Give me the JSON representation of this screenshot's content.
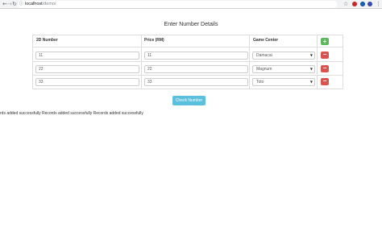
{
  "browser": {
    "url_host": "localhost",
    "url_path": "/demo/",
    "info_icon": "info-icon"
  },
  "page": {
    "title": "Enter Number Details"
  },
  "table": {
    "headers": [
      "2D Number",
      "Price (RM)",
      "Game Center"
    ],
    "rows": [
      {
        "number": "11",
        "price": "11",
        "center": "Damacai"
      },
      {
        "number": "22",
        "price": "22",
        "center": "Magnum"
      },
      {
        "number": "33",
        "price": "33",
        "center": "Toto"
      }
    ],
    "add_symbol": "+",
    "remove_symbol": "−"
  },
  "actions": {
    "check_label": "Check Number"
  },
  "status": {
    "message": "rds added successfully Records added successfully Records added successfully"
  },
  "colors": {
    "add": "#5cb85c",
    "remove": "#d9534f",
    "check": "#5bc0de"
  }
}
